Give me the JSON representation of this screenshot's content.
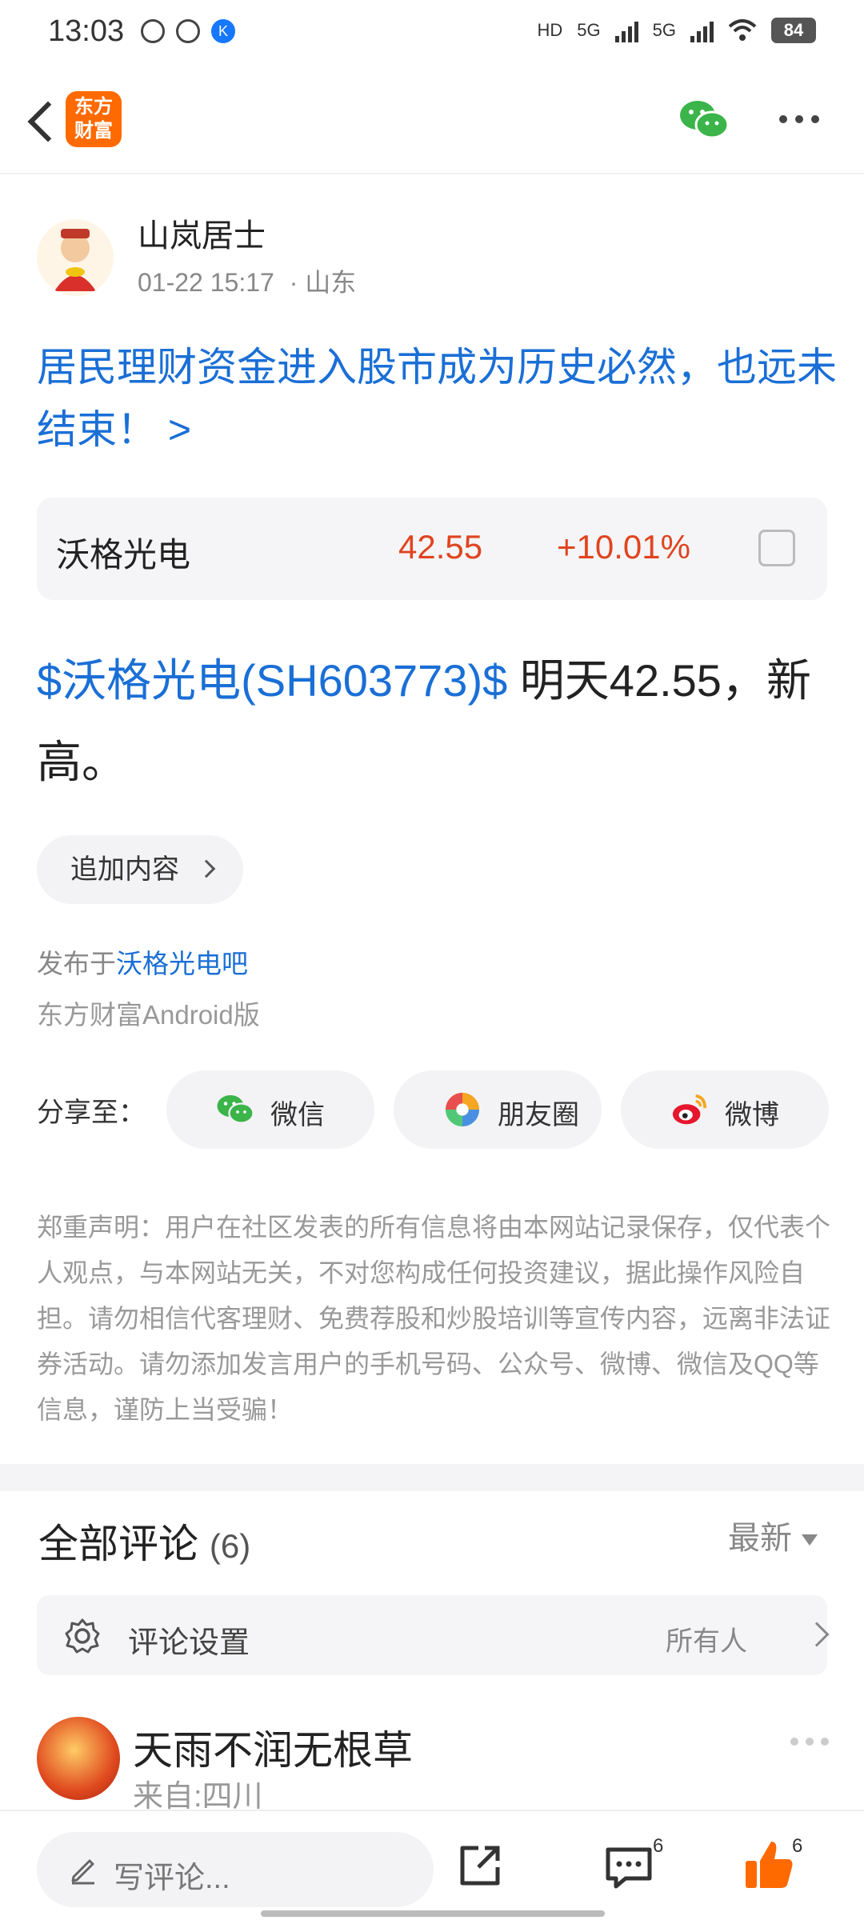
{
  "status_bar": {
    "time": "13:03",
    "battery": "84",
    "network_1": "5G",
    "network_2": "5G",
    "hd_label": "HD"
  },
  "header": {
    "logo_text_line1": "东方",
    "logo_text_line2": "财富"
  },
  "author": {
    "name": "山岚居士",
    "date": "01-22 15:17",
    "location": "· 山东"
  },
  "post": {
    "title": "居民理财资金进入股市成为历史必然，也远未结束！ >",
    "stock": {
      "name": "沃格光电",
      "price": "42.55",
      "change": "+10.01%"
    },
    "body_tag": "$沃格光电(SH603773)$",
    "body_text": " 明天42.55，新高。",
    "append_label": "追加内容",
    "published_prefix": "发布于",
    "published_bar": "沃格光电吧",
    "platform": "东方财富Android版"
  },
  "share": {
    "label": "分享至：",
    "wechat": "微信",
    "moments": "朋友圈",
    "weibo": "微博"
  },
  "disclaimer": "郑重声明：用户在社区发表的所有信息将由本网站记录保存，仅代表个人观点，与本网站无关，不对您构成任何投资建议，据此操作风险自担。请勿相信代客理财、免费荐股和炒股培训等宣传内容，远离非法证券活动。请勿添加发言用户的手机号码、公众号、微博、微信及QQ等信息，谨防上当受骗！",
  "comments": {
    "title": "全部评论",
    "count": "(6)",
    "sort": "最新",
    "settings_label": "评论设置",
    "settings_value": "所有人",
    "first": {
      "user": "天雨不润无根草",
      "from": "来自:四川"
    }
  },
  "bottom_bar": {
    "placeholder": "写评论...",
    "comment_count": "6",
    "like_count": "6"
  },
  "colors": {
    "link_blue": "#1a6fd6",
    "up_red": "#e0441f",
    "brand_orange": "#ff6a00",
    "wechat_green": "#3bb44a"
  }
}
